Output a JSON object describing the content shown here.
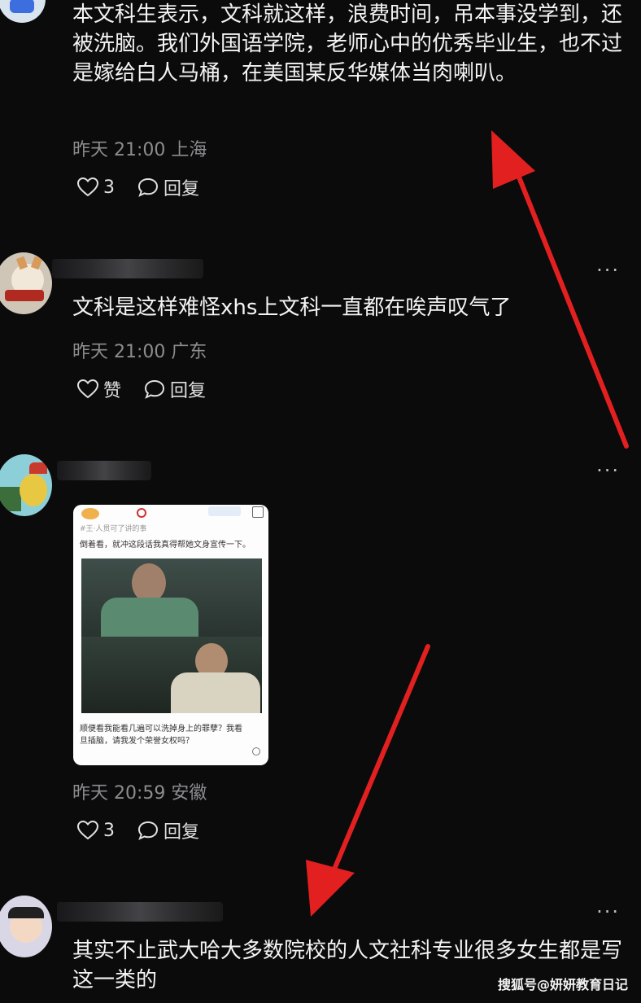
{
  "comments": [
    {
      "text": "本文科生表示，文科就这样，浪费时间，吊本事没学到，还被洗脑。我们外国语学院，老师心中的优秀毕业生，也不过是嫁给白人马桶，在美国某反华媒体当肉喇叭。",
      "meta": "昨天 21:00 上海",
      "likes": "3",
      "reply": "回复"
    },
    {
      "text": "文科是这样难怪xhs上文科一直都在唉声叹气了",
      "meta": "昨天 21:00 广东",
      "likes": "赞",
      "reply": "回复"
    },
    {
      "meta": "昨天 20:59 安徽",
      "likes": "3",
      "reply": "回复"
    },
    {
      "text": "其实不止武大哈大多数院校的人文社科专业很多女生都是写这一类的"
    }
  ],
  "card": {
    "top_text": "#王·人贯可了讲的事",
    "line1": "倒着看，就冲这段话我真得帮她文身宣传一下。",
    "caption": "顺便看我能看几遍可以洗掉身上的罪孽？我看旦插脑，请我发个荣誉女权吗？"
  },
  "more": "···",
  "watermark": "搜狐号@妍妍教育日记",
  "colors": {
    "background": "#0b0b0c",
    "meta": "#8d8d8f",
    "arrow": "#e1201f"
  }
}
